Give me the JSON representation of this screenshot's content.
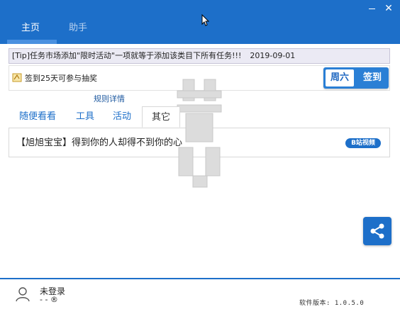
{
  "titlebar": {
    "tabs": [
      {
        "label": "主页",
        "active": true
      },
      {
        "label": "助手",
        "active": false
      }
    ],
    "minimize_icon": "minimize-icon",
    "close_icon": "close-icon",
    "close_glyph": "✕"
  },
  "tip": {
    "text": "[Tip]任务市场添加\"限时活动\"一项就等于添加该类目下所有任务!!!",
    "date": "2019-09-01"
  },
  "signin": {
    "text": "签到25天可参与抽奖",
    "weekday": "周六",
    "button_label": "签到",
    "rules_link": "规则详情"
  },
  "category_tabs": [
    {
      "label": "随便看看",
      "active": false
    },
    {
      "label": "工具",
      "active": false
    },
    {
      "label": "活动",
      "active": false
    },
    {
      "label": "其它",
      "active": true
    }
  ],
  "content": {
    "item_text": "【旭旭宝宝】得到你的人却得不到你的心",
    "badge": "B站视频"
  },
  "footer": {
    "user_name": "未登录",
    "user_score": "- - ®",
    "version": "软件版本: 1.0.5.0"
  },
  "colors": {
    "brand_blue": "#1d6fc9",
    "tip_bg": "#ebeaf4",
    "link": "#1f5aa0"
  }
}
